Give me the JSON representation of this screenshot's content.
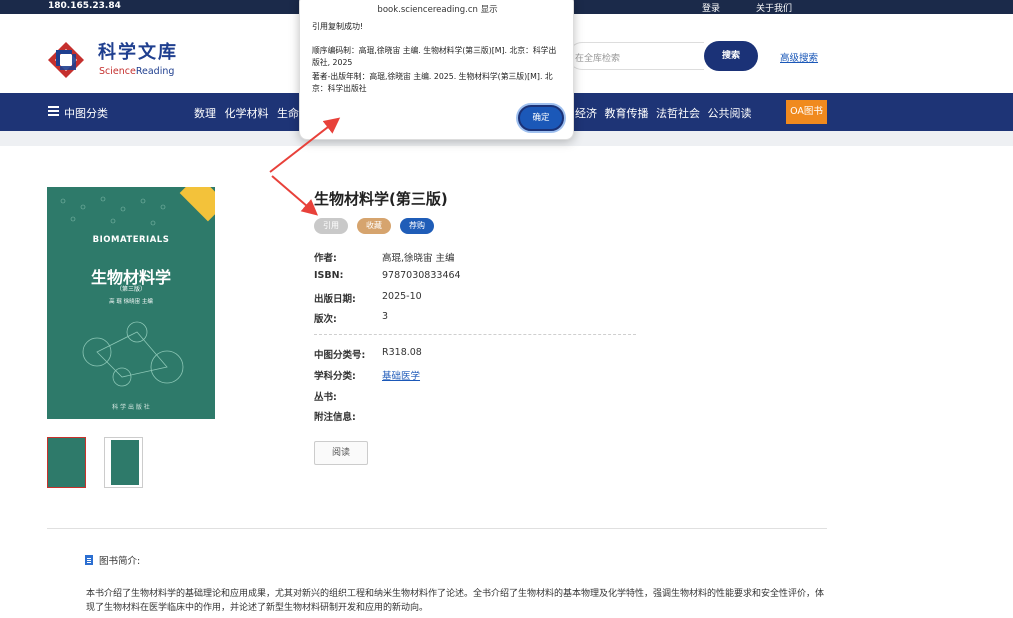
{
  "topbar": {
    "ip": "180.165.23.84",
    "login": "登录",
    "about": "关于我们"
  },
  "header": {
    "logo_cn": "科学文库",
    "logo_en_prefix": "Science",
    "logo_en_suffix": "Reading",
    "search_placeholder": "在全库检索",
    "search_button": "搜索",
    "advanced_search": "高级搜索"
  },
  "nav": {
    "category_label": "中图分类",
    "items_left": [
      "数理",
      "化学材料",
      "生命"
    ],
    "items_right": [
      "经济",
      "教育传播",
      "法哲社会",
      "公共阅读"
    ],
    "oa_button": "OA图书"
  },
  "book": {
    "title": "生物材料学(第三版)",
    "tags": {
      "cite": "引用",
      "favorite": "收藏",
      "buy": "荐购"
    },
    "fields_top": [
      {
        "key": "作者:",
        "value": "高琨,徐晓宙 主编"
      },
      {
        "key": "ISBN:",
        "value": "9787030833464"
      },
      {
        "key": "出版日期:",
        "value": "2025-10"
      },
      {
        "key": "版次:",
        "value": "3"
      }
    ],
    "fields_bottom": [
      {
        "key": "中图分类号:",
        "value": "R318.08"
      },
      {
        "key": "学科分类:",
        "value": "基础医学"
      },
      {
        "key": "丛书:",
        "value": ""
      },
      {
        "key": "附注信息:",
        "value": ""
      }
    ],
    "read_button": "阅读",
    "cover": {
      "en_title": "BIOMATERIALS",
      "cn_title": "生物材料学",
      "edition": "（第三版）",
      "authors": "高 琨 徐晓宙 主编",
      "publisher": "科 学 出 版 社"
    }
  },
  "intro": {
    "heading": "图书简介:",
    "text": "本书介绍了生物材料学的基础理论和应用成果，尤其对新兴的组织工程和纳米生物材料作了论述。全书介绍了生物材料的基本物理及化学特性，强调生物材料的性能要求和安全性评价，体现了生物材料在医学临床中的作用，并论述了新型生物材料研制开发和应用的新动向。"
  },
  "dialog": {
    "title": "book.sciencereading.cn 显示",
    "message": "引用复制成功!",
    "line1": "顺序编码制：高琨,徐晓宙 主编. 生物材料学(第三版)[M]. 北京：科学出版社, 2025",
    "line2": "著者-出版年制：高琨,徐晓宙 主编. 2025. 生物材料学(第三版)[M]. 北京：科学出版社",
    "ok": "确定"
  },
  "colors": {
    "topbar": "#1b2a4a",
    "nav": "#1e3476",
    "accent_blue": "#1b58b8",
    "oa_orange": "#f08a1e",
    "cover_green": "#2e7a6a",
    "arrow_red": "#e8413a"
  }
}
